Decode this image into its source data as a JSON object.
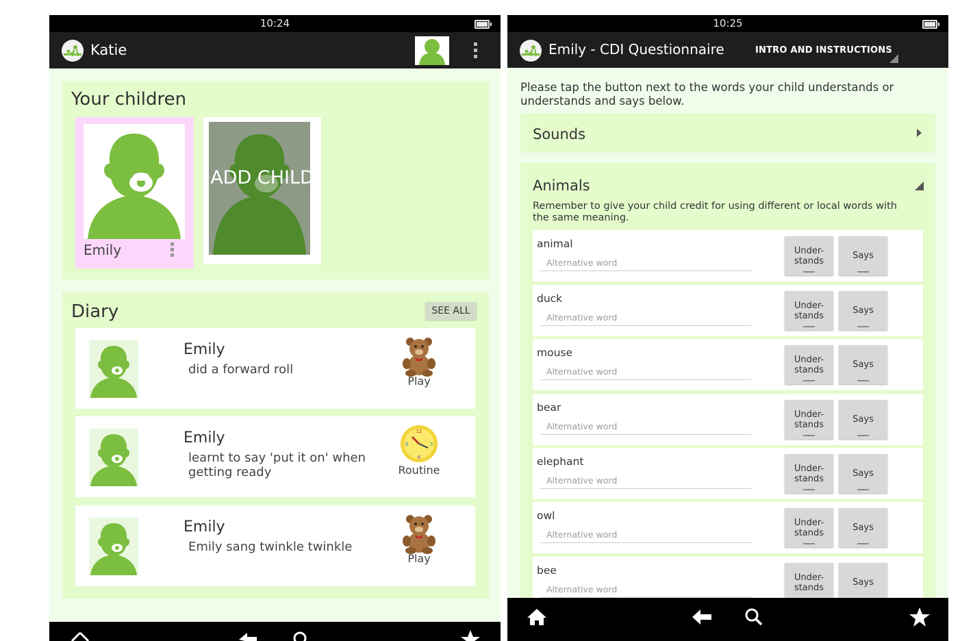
{
  "left_screen": {
    "status_time": "10:24",
    "app_title": "Katie",
    "children_section": {
      "title": "Your children",
      "children": [
        {
          "name": "Emily"
        }
      ],
      "add_child_label": "ADD CHILD"
    },
    "diary_section": {
      "title": "Diary",
      "see_all_label": "SEE ALL",
      "entries": [
        {
          "name": "Emily",
          "text": "did a forward roll",
          "tag": "Play",
          "tag_icon": "teddy-bear-icon"
        },
        {
          "name": "Emily",
          "text": "learnt to say 'put it on' when getting ready",
          "tag": "Routine",
          "tag_icon": "clock-icon"
        },
        {
          "name": "Emily",
          "text": "Emily sang twinkle twinkle",
          "tag": "Play",
          "tag_icon": "teddy-bear-icon"
        }
      ]
    }
  },
  "right_screen": {
    "status_time": "10:25",
    "app_title": "Emily - CDI Questionnaire",
    "tab_label": "INTRO AND INSTRUCTIONS",
    "instructions": "Please tap the button next to the words your child understands or understands and says below.",
    "sounds_label": "Sounds",
    "animals": {
      "label": "Animals",
      "note": "Remember to give your child credit for using different or local words with the same meaning.",
      "alt_placeholder": "Alternative word",
      "understands_label": "Under-\nstands",
      "says_label": "Says",
      "words": [
        "animal",
        "duck",
        "mouse",
        "bear",
        "elephant",
        "owl",
        "bee"
      ]
    }
  },
  "colors": {
    "background": "#f0fdeb",
    "card": "#e4fbcc",
    "child_tile": "#fdd6fb",
    "avatar_green": "#7cbe3f",
    "action_bar": "#1e1e1e"
  },
  "icons": [
    "app-logo-icon",
    "user-avatar-icon",
    "overflow-menu-icon",
    "home-icon",
    "back-icon",
    "search-icon",
    "star-icon"
  ]
}
